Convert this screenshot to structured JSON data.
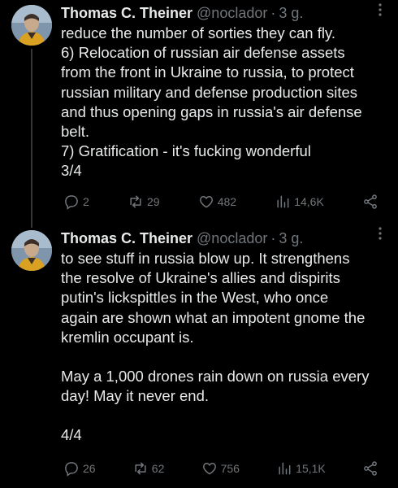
{
  "tweets": [
    {
      "author_name": "Thomas C. Theiner",
      "handle": "@noclador",
      "time": "3 g.",
      "lines": [
        "reduce the number of sorties they can fly.",
        "6) Relocation of russian air defense assets",
        "from the front in Ukraine to russia, to protect",
        "russian military and defense production sites",
        "and thus opening gaps in russia's air defense",
        "belt.",
        "7) Gratification - it's fucking wonderful",
        "3/4"
      ],
      "replies": "2",
      "retweets": "29",
      "likes": "482",
      "views": "14,6K"
    },
    {
      "author_name": "Thomas C. Theiner",
      "handle": "@noclador",
      "time": "3 g.",
      "lines": [
        "to see stuff in russia blow up. It strengthens",
        "the resolve of Ukraine's allies and dispirits",
        "putin's lickspittles in the West, who once",
        "again are shown what an impotent gnome the",
        "kremlin occupant is.",
        "",
        "May a 1,000 drones rain down on russia every",
        "day!  May it never end.",
        "",
        "4/4"
      ],
      "replies": "26",
      "retweets": "62",
      "likes": "756",
      "views": "15,1K"
    }
  ]
}
